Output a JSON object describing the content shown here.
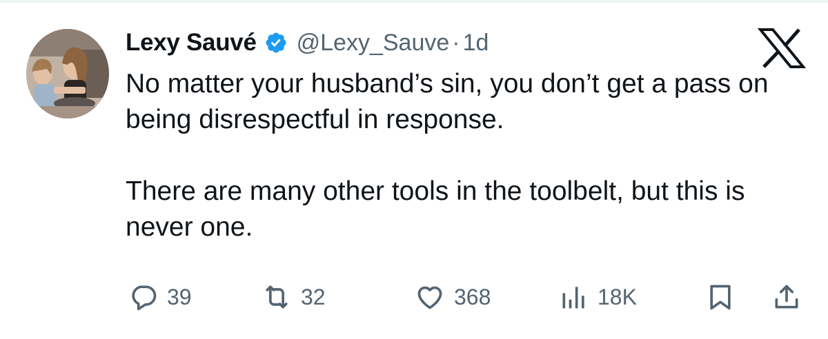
{
  "tweet": {
    "author_name": "Lexy Sauvé",
    "handle": "@Lexy_Sauve",
    "separator": "·",
    "time": "1d",
    "paragraphs": [
      "No matter your husband’s sin, you don’t get a pass on being disrespectful in response.",
      "There are many other tools in the toolbelt, but this is never one."
    ]
  },
  "actions": {
    "replies": "39",
    "reposts": "32",
    "likes": "368",
    "views": "18K"
  },
  "icons": {
    "verified": "verified-badge-icon",
    "brand": "x-logo-icon",
    "reply": "reply-icon",
    "repost": "repost-icon",
    "like": "heart-icon",
    "views": "views-chart-icon",
    "bookmark": "bookmark-icon",
    "share": "share-icon"
  },
  "colors": {
    "verified": "#1d9bf0",
    "text": "#0f1419",
    "muted": "#536471"
  }
}
